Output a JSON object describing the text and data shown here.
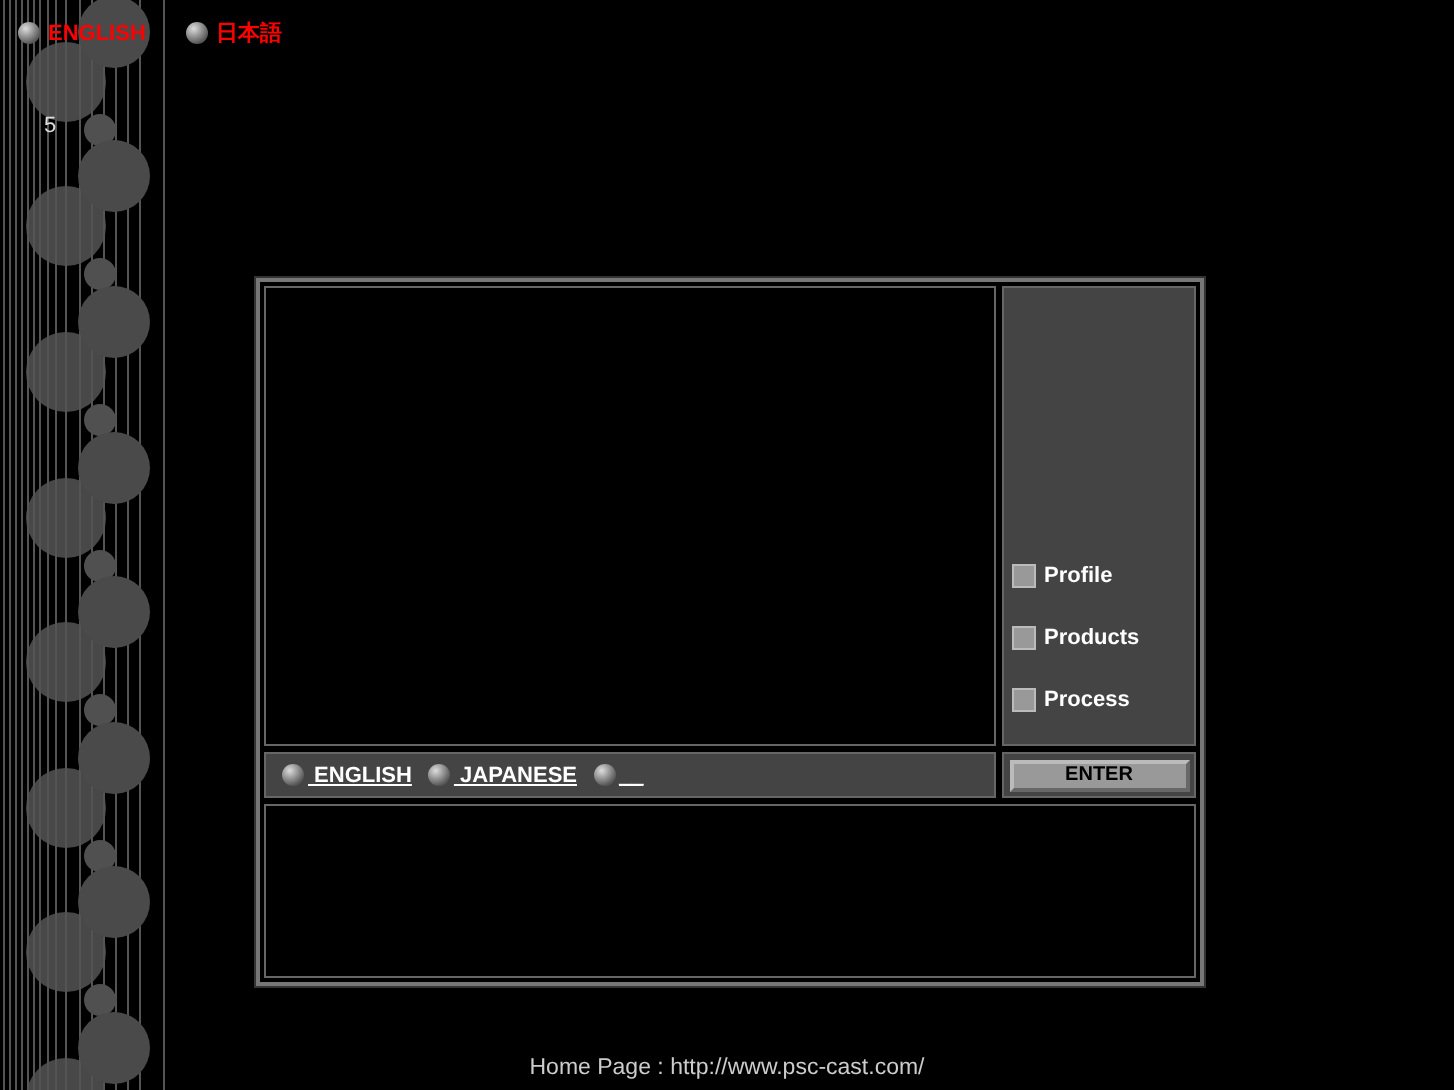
{
  "language_links": [
    {
      "label": "ENGLISH"
    },
    {
      "label": "日本語"
    }
  ],
  "counter": "5",
  "menu": [
    {
      "label": "Profile"
    },
    {
      "label": "Products"
    },
    {
      "label": "Process"
    }
  ],
  "bar_links": [
    {
      "label": " ENGLISH"
    },
    {
      "label": " JAPANESE"
    },
    {
      "label": "__"
    }
  ],
  "enter_button": "ENTER",
  "footer": "Home Page : http://www.psc-cast.com/"
}
